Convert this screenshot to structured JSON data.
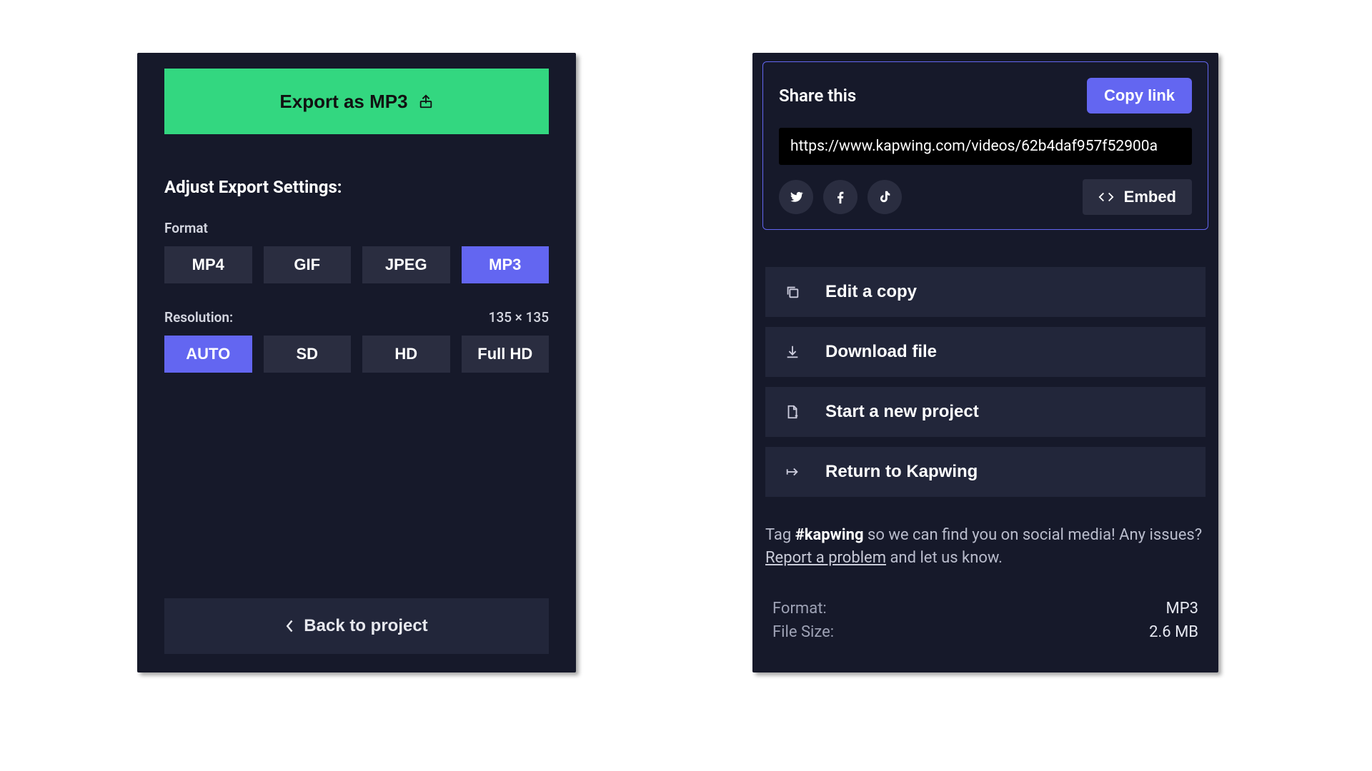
{
  "export": {
    "button_label": "Export as MP3",
    "settings_heading": "Adjust Export Settings:",
    "format_label": "Format",
    "formats": [
      "MP4",
      "GIF",
      "JPEG",
      "MP3"
    ],
    "format_selected": "MP3",
    "resolution_label": "Resolution:",
    "dimensions": "135 × 135",
    "resolutions": [
      "AUTO",
      "SD",
      "HD",
      "Full HD"
    ],
    "resolution_selected": "AUTO",
    "back_label": "Back to project"
  },
  "share": {
    "title": "Share this",
    "copy_link_label": "Copy link",
    "url": "https://www.kapwing.com/videos/62b4daf957f52900a",
    "embed_label": "Embed",
    "actions": {
      "edit_copy": "Edit a copy",
      "download": "Download file",
      "new_project": "Start a new project",
      "return": "Return to Kapwing"
    },
    "blurb_pre": "Tag ",
    "blurb_tag": "#kapwing",
    "blurb_mid": " so we can find you on social media! Any issues?  ",
    "blurb_link": "Report a problem",
    "blurb_post": "  and let us know.",
    "meta": {
      "format_label": "Format:",
      "format_value": "MP3",
      "size_label": "File Size:",
      "size_value": "2.6 MB"
    }
  }
}
